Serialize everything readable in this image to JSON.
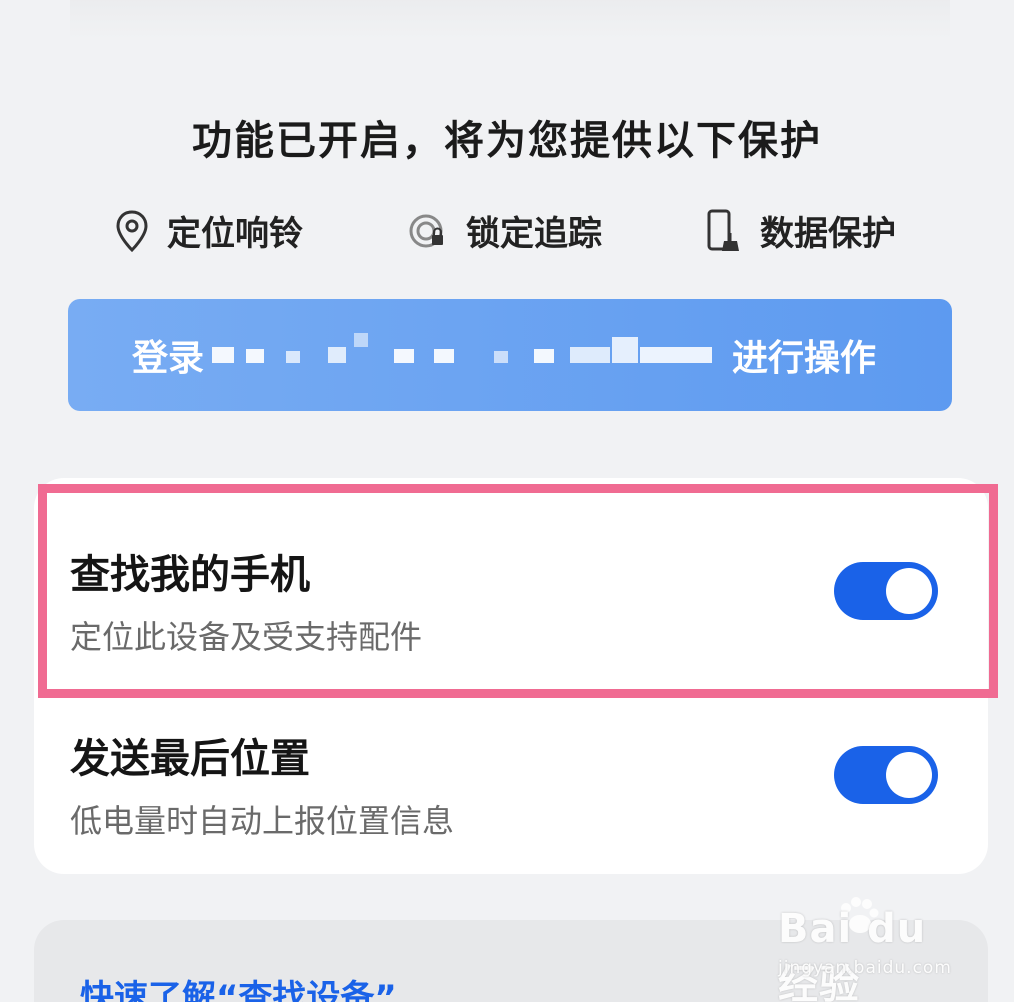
{
  "header": {
    "title": "功能已开启，将为您提供以下保护"
  },
  "features": [
    {
      "label": "定位响铃",
      "icon": "location-pin-icon"
    },
    {
      "label": "锁定追踪",
      "icon": "lock-tracking-icon"
    },
    {
      "label": "数据保护",
      "icon": "phone-clean-icon"
    }
  ],
  "login": {
    "prefix": "登录",
    "suffix": "进行操作"
  },
  "settings": [
    {
      "title": "查找我的手机",
      "subtitle": "定位此设备及受支持配件",
      "enabled": true
    },
    {
      "title": "发送最后位置",
      "subtitle": "低电量时自动上报位置信息",
      "enabled": true
    }
  ],
  "info": {
    "link": "快速了解“查找设备”"
  },
  "watermark": {
    "brand": "Bai du 经验",
    "site": "jingyan.baidu.com"
  },
  "colors": {
    "accent": "#1a62e8",
    "highlight": "#f06b92",
    "login_button": "#5d9af0"
  }
}
